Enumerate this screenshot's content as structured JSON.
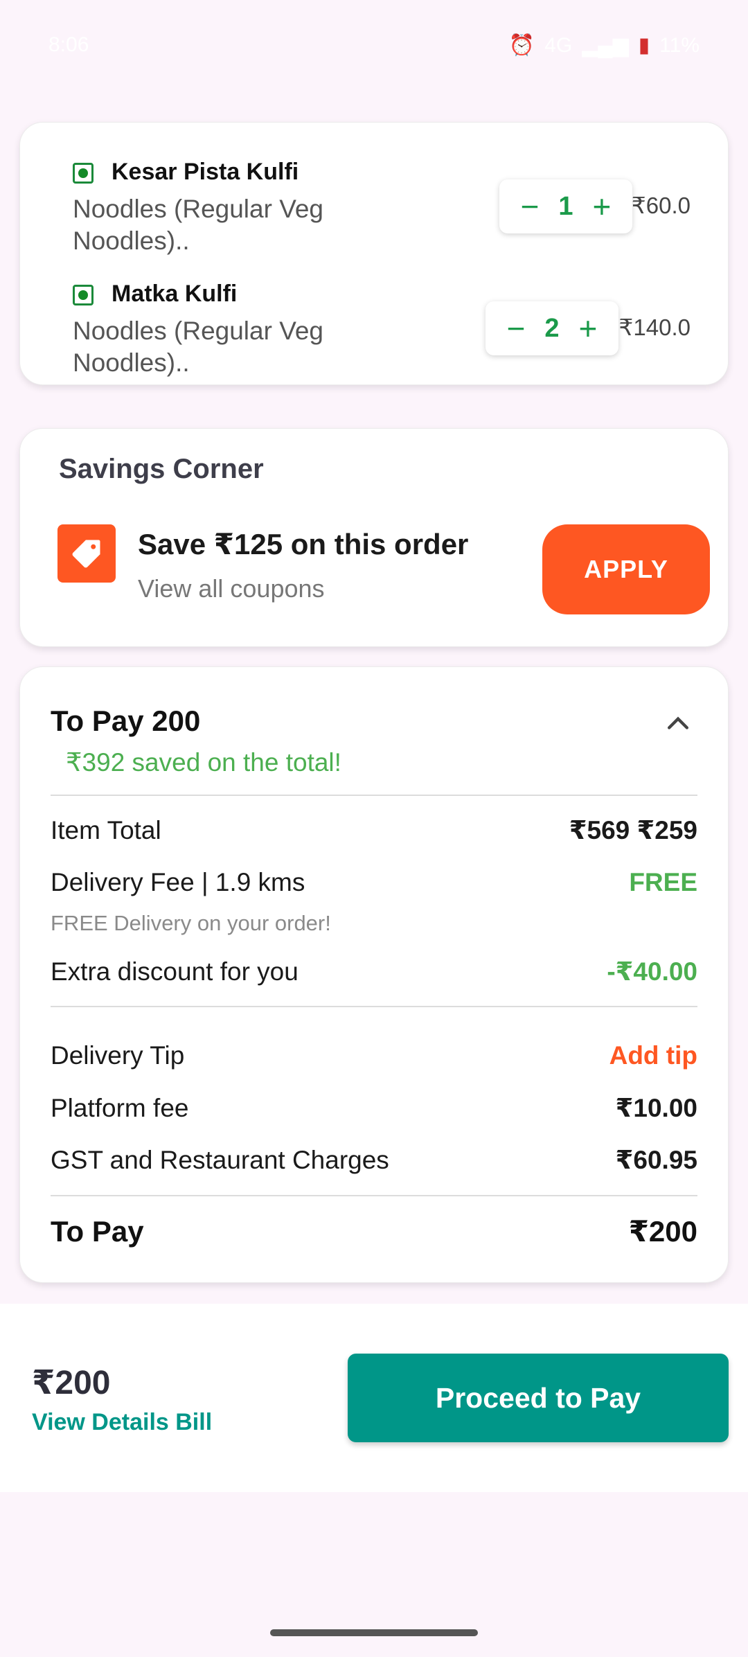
{
  "status": {
    "time": "8:06",
    "network": "4G",
    "battery": "11%"
  },
  "cart": {
    "items": [
      {
        "name": "Kesar Pista Kulfi",
        "desc": "Noodles (Regular Veg Noodles)..",
        "qty": "1",
        "price": "₹60.0"
      },
      {
        "name": "Matka Kulfi",
        "desc": "Noodles (Regular Veg Noodles)..",
        "qty": "2",
        "price": "₹140.0"
      }
    ]
  },
  "savings": {
    "title": "Savings Corner",
    "offer": "Save ₹125 on this order",
    "view_all": "View all coupons",
    "apply": "APPLY"
  },
  "bill": {
    "title": "To Pay 200",
    "saved": "₹392 saved on the total!",
    "rows": [
      {
        "label": "Item Total",
        "value": "₹569 ₹259"
      },
      {
        "label": "Delivery Fee | 1.9 kms",
        "value": "FREE"
      },
      {
        "label": "Extra discount for you",
        "value": "-₹40.00"
      },
      {
        "label": "Delivery Tip",
        "value": "Add tip"
      },
      {
        "label": "Platform fee",
        "value": "₹10.00"
      },
      {
        "label": "GST and Restaurant Charges",
        "value": "₹60.95"
      }
    ],
    "free_note": "FREE Delivery on your order!",
    "total_label": "To Pay",
    "total_value": "₹200"
  },
  "footer": {
    "amount": "₹200",
    "view_details": "View Details Bill",
    "proceed": "Proceed to Pay"
  },
  "colors": {
    "accent_orange": "#fe5722",
    "accent_teal": "#009688",
    "green": "#4caf50"
  }
}
